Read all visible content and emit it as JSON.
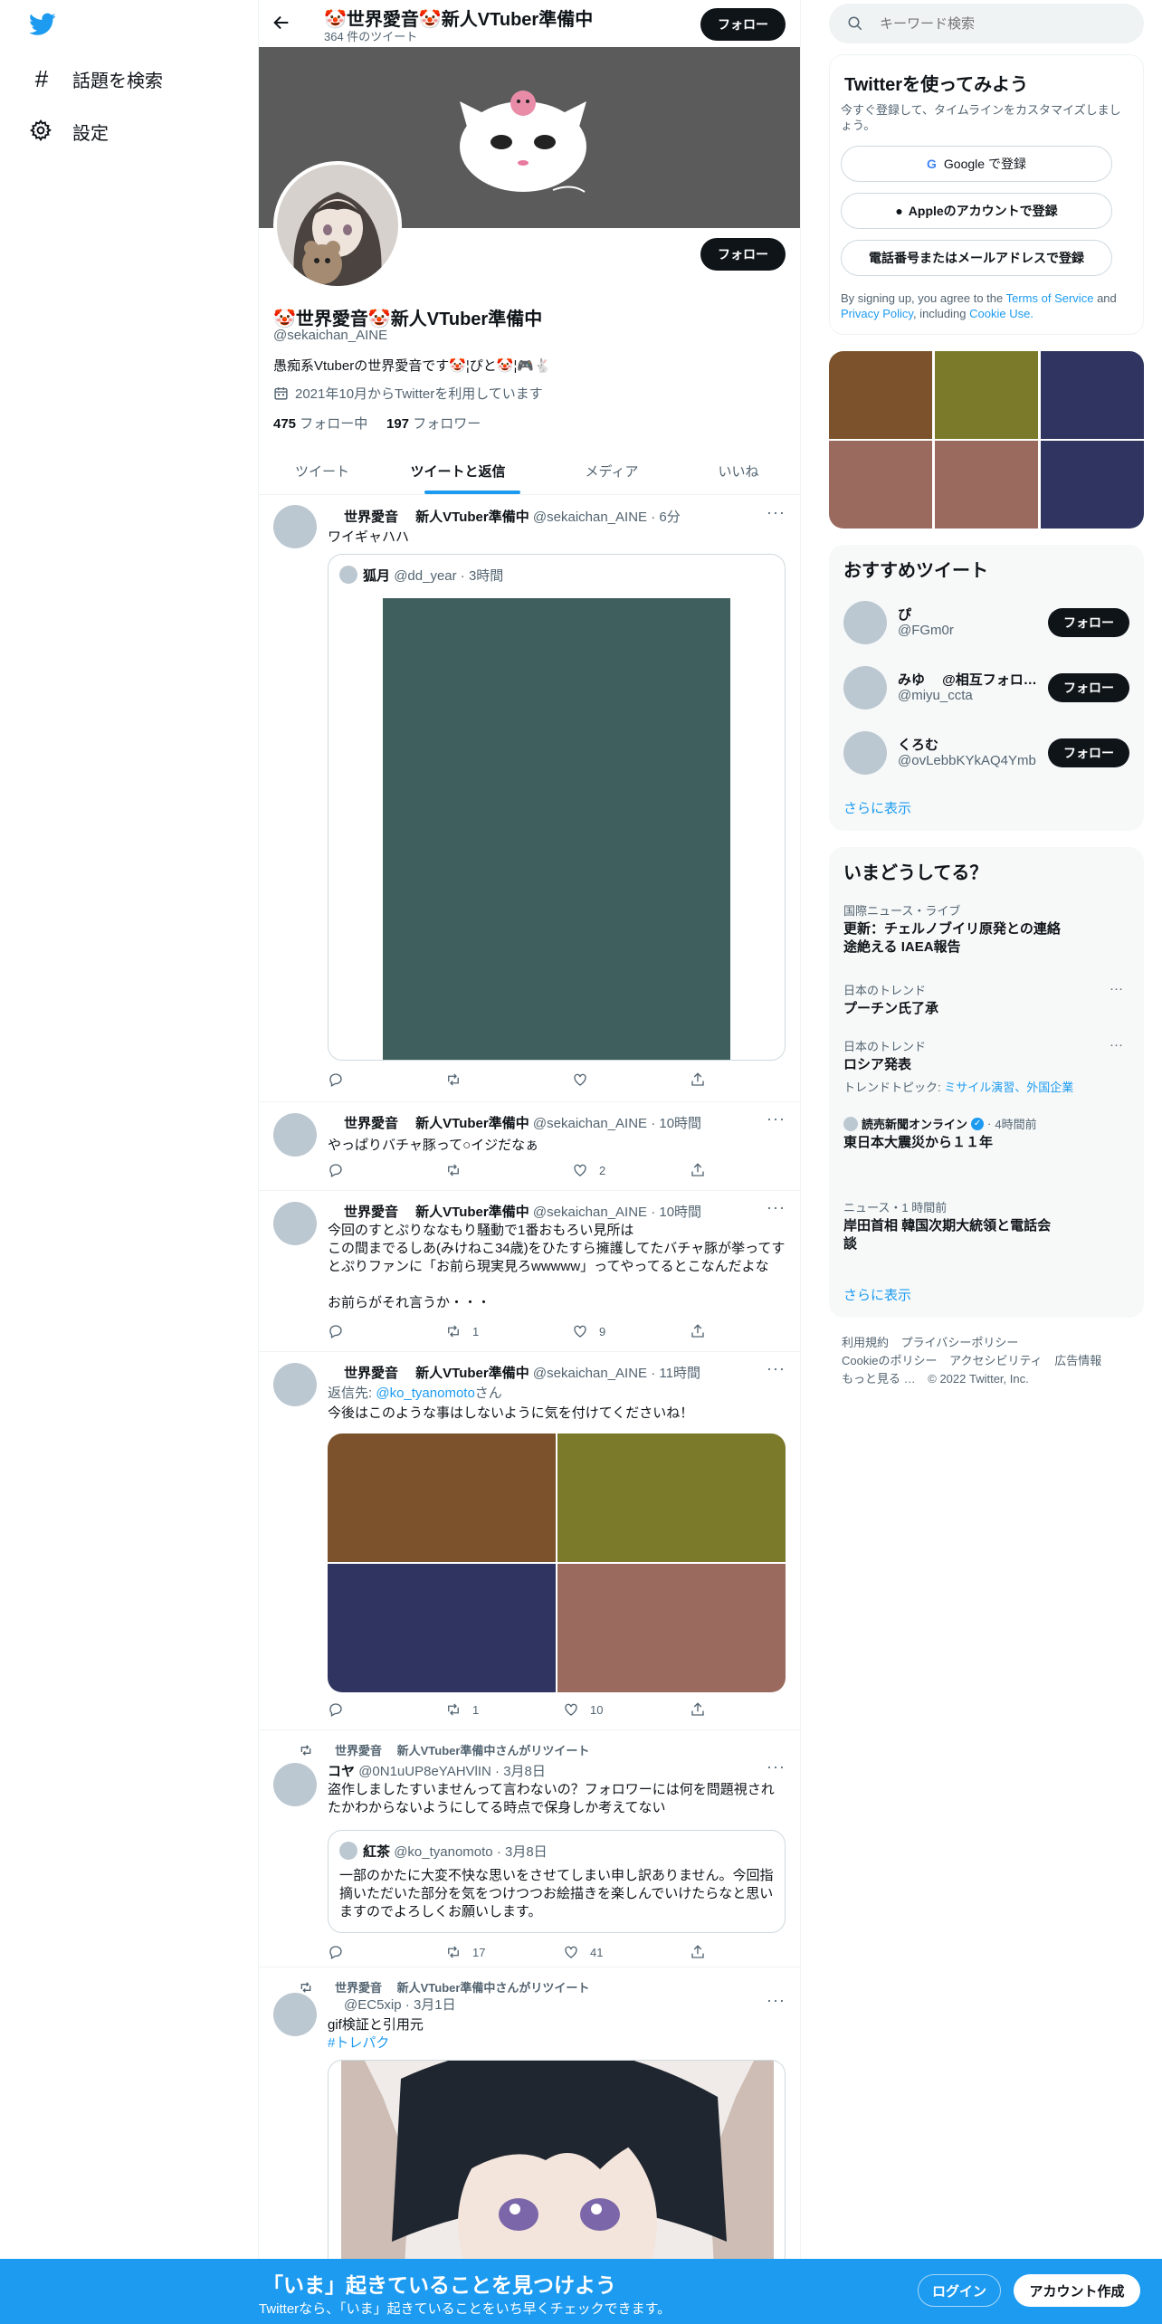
{
  "sidebar": {
    "items": [
      {
        "label": "話題を検索"
      },
      {
        "label": "設定"
      }
    ]
  },
  "header": {
    "name": "🤡世界愛音🤡新人VTuber準備中",
    "tweet_count": "364 件のツイート",
    "follow_label": "フォロー"
  },
  "profile": {
    "name": "🤡世界愛音🤡新人VTuber準備中",
    "handle": "@sekaichan_AINE",
    "bio": "愚痴系Vtuberの世界愛音です🤡¦ぴと🤡¦🎮🐇",
    "joined": "2021年10月からTwitterを利用しています",
    "following_count": "475",
    "following_label": "フォロー中",
    "followers_count": "197",
    "followers_label": "フォロワー",
    "follow_label": "フォロー"
  },
  "tabs": [
    "ツイート",
    "ツイートと返信",
    "メディア",
    "いいね"
  ],
  "tweets": [
    {
      "name": "世界愛音　 新人VTuber準備中",
      "handle": "@sekaichan_AINE",
      "time": "6分",
      "text": "ワイギャハハ",
      "quote": {
        "name": "狐月",
        "handle": "@dd_year",
        "time": "3時間"
      },
      "replies": "",
      "retweets": "",
      "likes": ""
    },
    {
      "name": "世界愛音　 新人VTuber準備中",
      "handle": "@sekaichan_AINE",
      "time": "10時間",
      "text": "やっぱりバチャ豚って○イジだなぁ",
      "replies": "",
      "retweets": "",
      "likes": "2"
    },
    {
      "name": "世界愛音　 新人VTuber準備中",
      "handle": "@sekaichan_AINE",
      "time": "10時間",
      "text_lines": [
        "今回のすとぷりななもり騒動で1番おもろい見所は",
        "この間までるしあ(みけねこ34歳)をひたすら擁護してたバチャ豚が挙ってす",
        "とぷりファンに「お前ら現実見ろwwwww」ってやってるとこなんだよな",
        "",
        "お前らがそれ言うか・・・"
      ],
      "replies": "",
      "retweets": "1",
      "likes": "9"
    },
    {
      "name": "世界愛音　 新人VTuber準備中",
      "handle": "@sekaichan_AINE",
      "time": "11時間",
      "reply_prefix": "返信先:",
      "reply_to": "@ko_tyanomoto",
      "reply_suffix": "さん",
      "text": "今後はこのような事はしないように気を付けてくださいね！",
      "replies": "",
      "retweets": "1",
      "likes": "10"
    },
    {
      "rt_label": "世界愛音　 新人VTuber準備中さんがリツイート",
      "name": "コヤ",
      "handle": "@0N1uUP8eYAHVlIN",
      "time": "3月8日",
      "text_lines": [
        "盗作しましたすいませんって言わないの？フォロワーには何を問題視され",
        "たかわからないようにしてる時点で保身しか考えてない"
      ],
      "quote": {
        "name": "紅茶",
        "handle": "@ko_tyanomoto",
        "time": "3月8日",
        "text_lines": [
          "一部のかたに大変不快な思いをさせてしまい申し訳ありません。今回指",
          "摘いただいた部分を気をつけつつお絵描きを楽しんでいけたらなと思い",
          "ますのでよろしくお願いします。"
        ]
      },
      "replies": "",
      "retweets": "17",
      "likes": "41"
    },
    {
      "rt_label": "世界愛音　 新人VTuber準備中さんがリツイート",
      "name": "",
      "handle": "@EC5xip",
      "time": "3月1日",
      "text": "gif検証と引用元",
      "hashtag": "#トレパク"
    }
  ],
  "search": {
    "placeholder": "キーワード検索"
  },
  "signup": {
    "title": "Twitterを使ってみよう",
    "subtitle": "今すぐ登録して、タイムラインをカスタマイズしましょう。",
    "google": "Google で登録",
    "apple": "Appleのアカウントで登録",
    "phone": "電話番号またはメールアドレスで登録",
    "terms_pre": "By signing up, you agree to the",
    "terms_link": "Terms of Service",
    "terms_and": "and",
    "privacy_link": "Privacy Policy",
    "terms_including": ", including",
    "cookie_link": "Cookie Use."
  },
  "recommended": {
    "title": "おすすめツイート",
    "users": [
      {
        "name": "ぴ",
        "handle": "@FGm0r",
        "follow": "フォロー"
      },
      {
        "name": "みゆ　 @相互フォロ…",
        "handle": "@miyu_ccta",
        "follow": "フォロー"
      },
      {
        "name": "くろむ",
        "handle": "@ovLebbKYkAQ4Ymb",
        "follow": "フォロー"
      }
    ],
    "show_more": "さらに表示"
  },
  "trends": {
    "title": "いまどうしてる？",
    "items": [
      {
        "category": "国際ニュース・ライブ",
        "title": "更新：チェルノブイリ原発との連絡途絶える IAEA報告"
      },
      {
        "category": "日本のトレンド",
        "title": "プーチン氏了承"
      },
      {
        "category": "日本のトレンド",
        "title": "ロシア発表",
        "topics_label": "トレンドトピック:",
        "topics": "ミサイル演習、外国企業"
      },
      {
        "source": "読売新聞オンライン",
        "time": "4時間前",
        "title": "東日本大震災から１１年"
      },
      {
        "category": "ニュース・1 時間前",
        "title": "岸田首相 韓国次期大統領と電話会談"
      }
    ],
    "show_more": "さらに表示"
  },
  "footer": {
    "links": [
      "利用規約",
      "プライバシーポリシー",
      "Cookieのポリシー",
      "アクセシビリティ",
      "広告情報",
      "もっと見る …"
    ],
    "copyright": "© 2022 Twitter, Inc."
  },
  "banner": {
    "title": "「いま」起きていることを見つけよう",
    "subtitle": "Twitterなら、「いま」起きていることをいち早くチェックできます。",
    "login": "ログイン",
    "signup": "アカウント作成"
  },
  "colors": {
    "accent": "#1d9bf0",
    "banner_bg": "#1d9bf0",
    "header_bg": "#5b5b5b"
  }
}
